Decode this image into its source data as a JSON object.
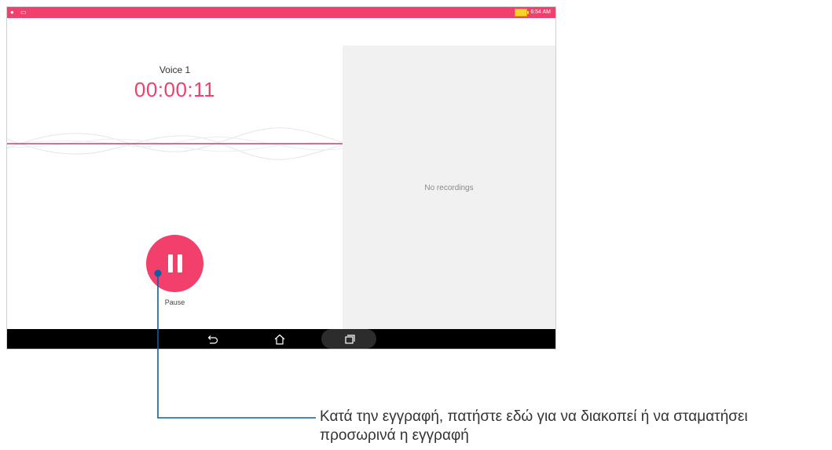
{
  "status_bar": {
    "time": "6:54 AM",
    "left_icons": [
      "record-indicator-icon",
      "message-icon"
    ]
  },
  "recorder": {
    "recording_name": "Voice 1",
    "elapsed": "00:00:11",
    "control_label": "Pause",
    "control_icon": "pause-icon",
    "accent_color": "#f33f6b"
  },
  "recordings_panel": {
    "empty_text": "No recordings"
  },
  "nav_bar": {
    "buttons": [
      "back-icon",
      "home-icon",
      "recent-apps-icon"
    ]
  },
  "callout": {
    "text_line1": "Κατά την εγγραφή, πατήστε εδώ για να διακοπεί ή να σταματήσει",
    "text_line2": "προσωρινά η εγγραφή",
    "line_color": "#0b5fa5"
  }
}
